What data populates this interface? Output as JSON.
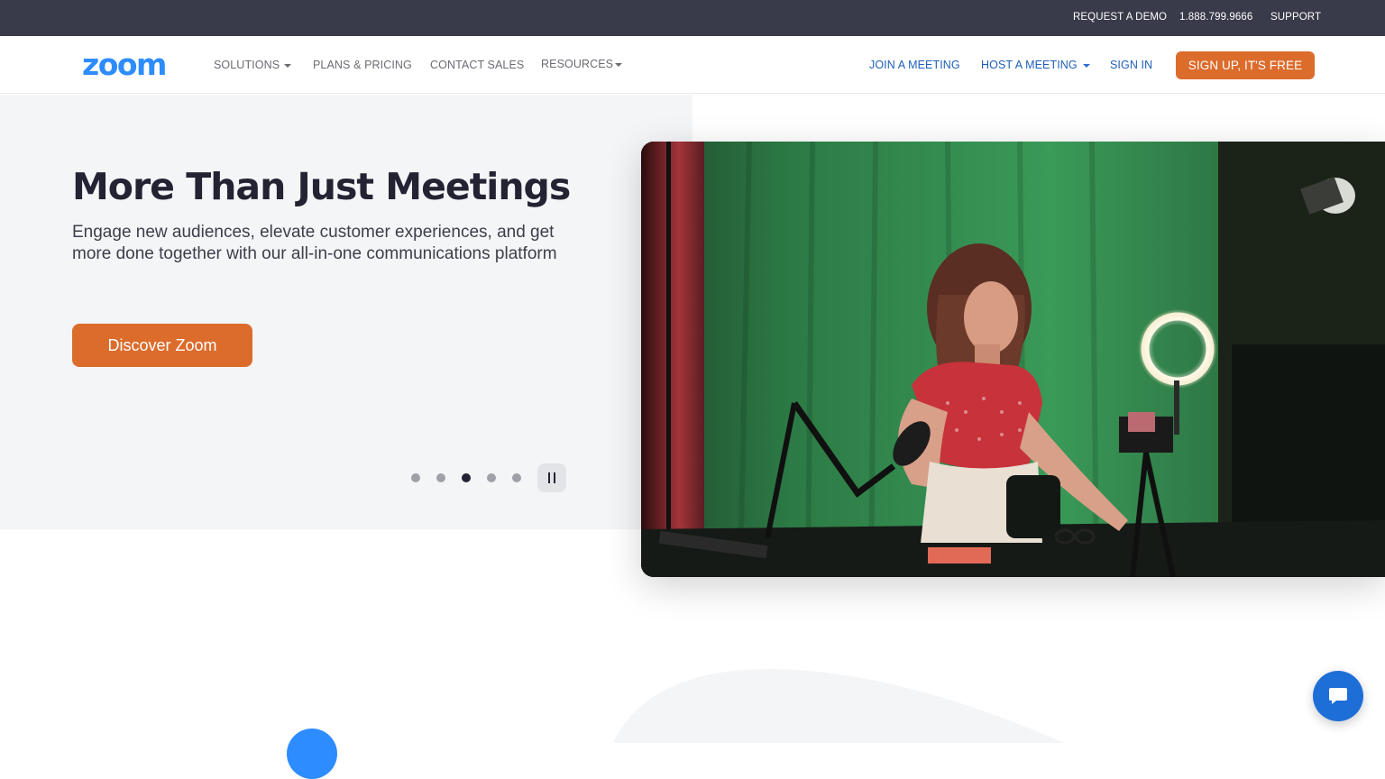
{
  "topbar": {
    "request_demo": "REQUEST A DEMO",
    "phone": "1.888.799.9666",
    "support": "SUPPORT"
  },
  "nav": {
    "logo": "zoom",
    "solutions": "SOLUTIONS",
    "plans_pricing": "PLANS & PRICING",
    "contact_sales": "CONTACT SALES",
    "resources": "RESOURCES",
    "join_meeting": "JOIN A MEETING",
    "host_meeting": "HOST A MEETING",
    "sign_in": "SIGN IN",
    "sign_up": "SIGN UP, IT'S FREE"
  },
  "hero": {
    "title": "More Than Just Meetings",
    "subtitle": "Engage new audiences, elevate customer experiences, and get more done together with our all-in-one communications platform",
    "cta": "Discover Zoom",
    "carousel": {
      "slide_count": 5,
      "active_slide": 3
    }
  },
  "colors": {
    "brand_blue": "#2d8cff",
    "accent_orange": "#dc6c2c",
    "topbar_bg": "#393a4a",
    "nav_link_blue": "#1f5fb8"
  },
  "icons": {
    "pause": "pause-icon",
    "chat": "chat-bubble-icon",
    "caret": "caret-down-icon"
  }
}
